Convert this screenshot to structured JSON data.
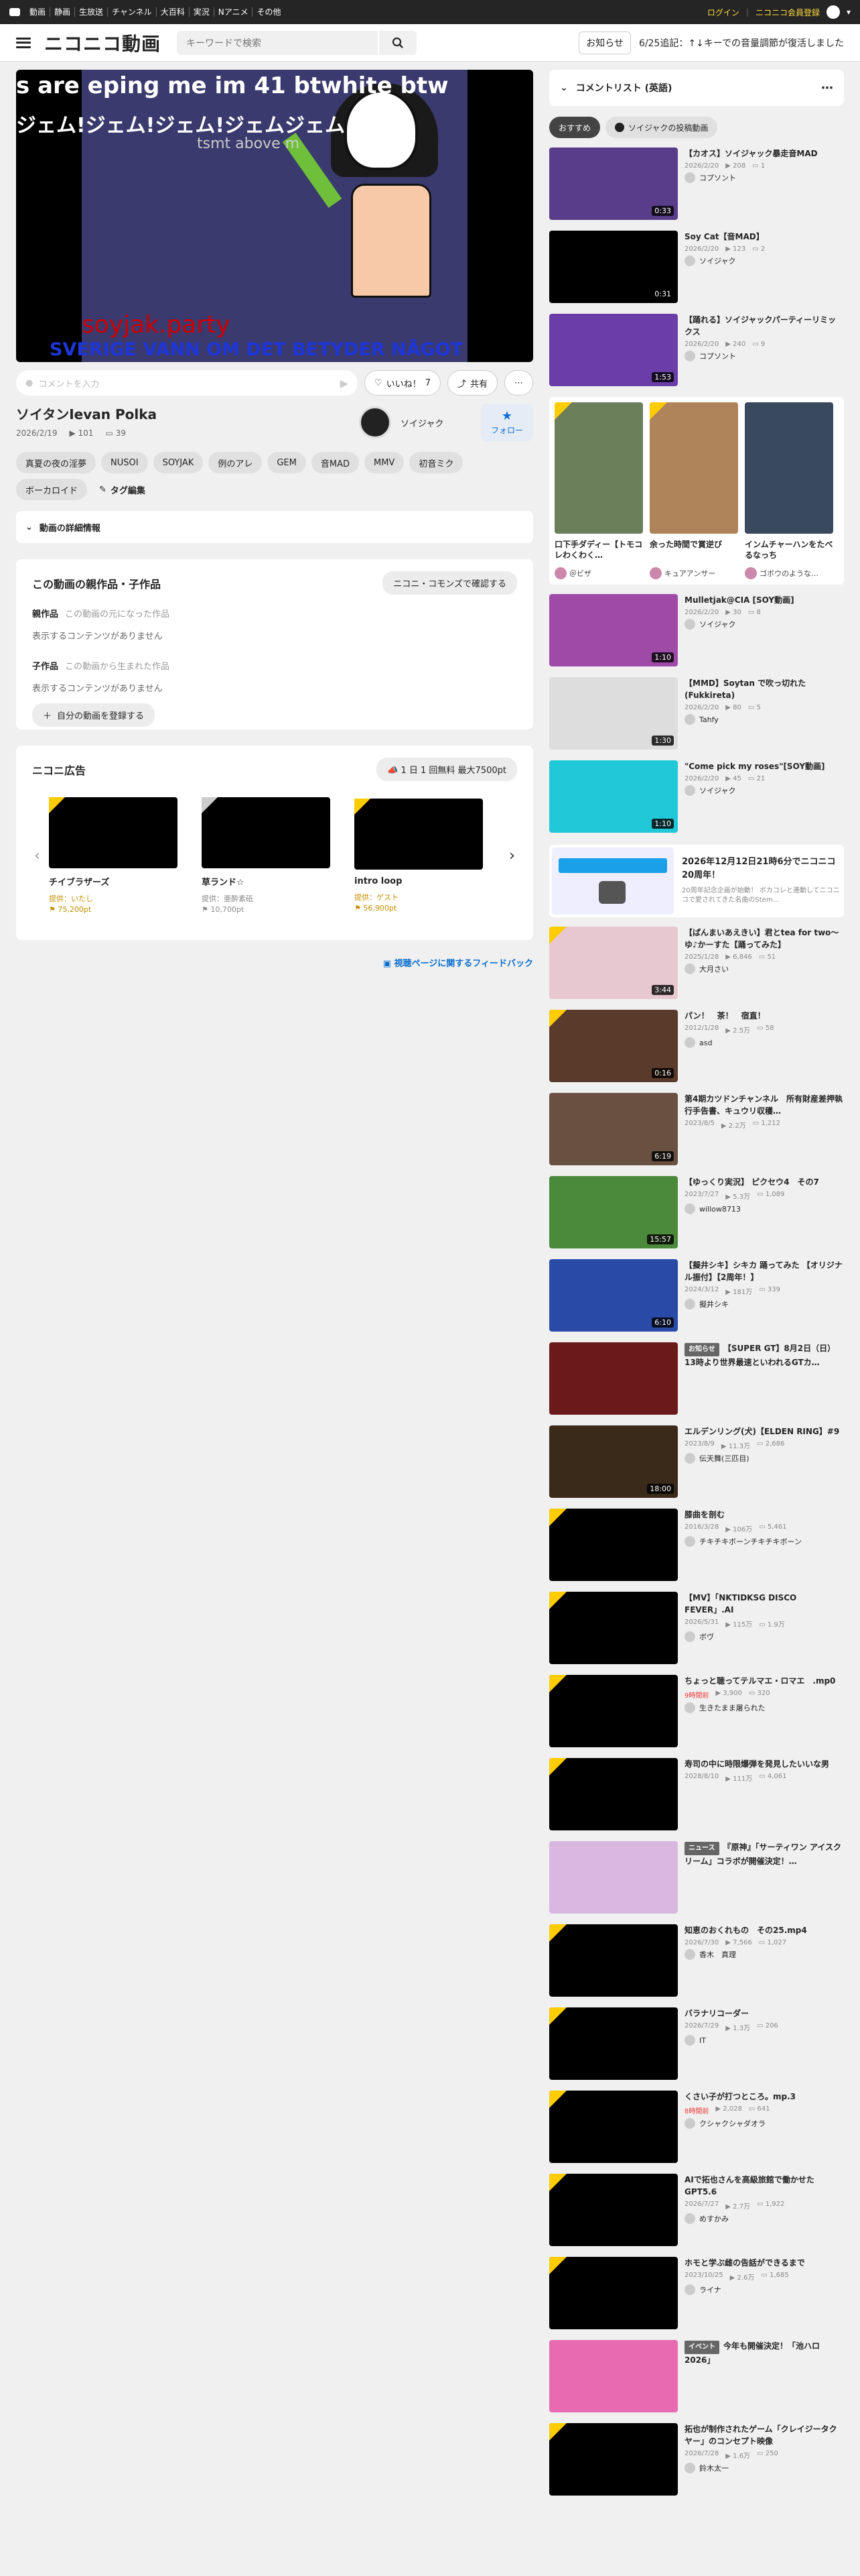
{
  "topbar": {
    "nav": [
      "動画",
      "静画",
      "生放送",
      "チャンネル",
      "大百科",
      "実況",
      "Nアニメ",
      "その他"
    ],
    "login": "ログイン",
    "register": "ニコニコ会員登録"
  },
  "header": {
    "logo": "ニコニコ動画",
    "search_placeholder": "キーワードで検索",
    "notice_label": "お知らせ",
    "notice_text": "6/25追記：↑↓キーでの音量調節が復活しました"
  },
  "player": {
    "line1": "s are eping me im 41 btwhite btw",
    "line2": "ジェム!ジェム!ジェム!ジェムジェム",
    "line3": "tsmt above m",
    "line4": "soyjak.party",
    "line5": "SVERIGE VANN OM DET BETYDER NÅGOT"
  },
  "commentbar": {
    "placeholder": "コメントを入力",
    "like_label": "いいね！",
    "like_count": "7",
    "share_label": "共有",
    "more": "⋯"
  },
  "video": {
    "title": "ソイタンIevan Polka",
    "date": "2026/2/19",
    "views": "101",
    "comments": "39",
    "owner": "ソイジャク",
    "follow_label": "フォロー"
  },
  "tags": [
    "真夏の夜の淫夢",
    "NUSOI",
    "SOYJAK",
    "例のアレ",
    "GEM",
    "音MAD",
    "MMV",
    "初音ミク",
    "ボーカロイド"
  ],
  "tag_edit": "タグ編集",
  "detail_label": "動画の詳細情報",
  "parents": {
    "title": "この動画の親作品・子作品",
    "commons_btn": "ニコニ・コモンズで確認する",
    "parent_label": "親作品",
    "parent_sub": "この動画の元になった作品",
    "parent_empty": "表示するコンテンツがありません",
    "child_label": "子作品",
    "child_sub": "この動画から生まれた作品",
    "child_empty": "表示するコンテンツがありません",
    "register_btn": "自分の動画を登録する"
  },
  "ads": {
    "title": "ニコニ広告",
    "free_btn": "1 日 1 回無料 最大7500pt",
    "items": [
      {
        "name": "チイブラザーズ",
        "provider": "提供：いたし",
        "points": "75,200pt",
        "gray": false
      },
      {
        "name": "草ランド☆",
        "provider": "提供：亜酔素砥",
        "points": "10,700pt",
        "gray": true
      },
      {
        "name": "intro loop",
        "provider": "提供：ゲスト",
        "points": "56,900pt",
        "gray": false
      }
    ]
  },
  "feedback": "視聴ページに関するフィードバック",
  "side": {
    "comment_list": "コメントリスト (英語)",
    "tab_recommend": "おすすめ",
    "tab_owner": "ソイジャクの投稿動画"
  },
  "recs_top": [
    {
      "title": "【カオス】ソイジャック暴走音MAD",
      "date": "2026/2/20",
      "views": "208",
      "comments": "1",
      "owner": "コプソント",
      "dur": "0:33",
      "bg": "#5a3d8a"
    },
    {
      "title": "Soy Cat【音MAD】",
      "date": "2026/2/20",
      "views": "123",
      "comments": "2",
      "owner": "ソイジャク",
      "dur": "0:31",
      "bg": "#000000"
    },
    {
      "title": "【踊れる】ソイジャックパーティーリミックス",
      "date": "2026/2/20",
      "views": "240",
      "comments": "9",
      "owner": "コプソント",
      "dur": "1:53",
      "bg": "#6b3da8"
    }
  ],
  "side_ads": [
    {
      "title": "口下手ダディー【トモコレわくわく…",
      "owner": "＠ビザ",
      "bg": "#6b7f5a"
    },
    {
      "title": "余った時間で賞逆び",
      "owner": "キュアアンサー",
      "bg": "#b0845a"
    },
    {
      "title": "インムチャーハンをたべるなっち",
      "owner": "ゴボウのような…",
      "bg": "#3a4a5e"
    }
  ],
  "recs_mid": [
    {
      "title": "Mulletjak@CIA [SOY動画]",
      "date": "2026/2/20",
      "views": "30",
      "comments": "8",
      "owner": "ソイジャク",
      "dur": "1:10",
      "bg": "#a04aa8"
    },
    {
      "title": "【MMD】Soytan で吹っ切れた(Fukkireta)",
      "date": "2026/2/20",
      "views": "80",
      "comments": "5",
      "owner": "Tahfy",
      "dur": "1:30",
      "bg": "#dddddd"
    },
    {
      "title": "\"Come pick my roses\"[SOY動画]",
      "date": "2026/2/20",
      "views": "45",
      "comments": "21",
      "owner": "ソイジャク",
      "dur": "1:10",
      "bg": "#20c8d8"
    }
  ],
  "promo": {
    "title": "2026年12月12日21時6分でニコニコ20周年！",
    "desc": "20周年記念企画が始動！ ボカコレと連動してニコニコで愛されてきた名曲のStem..."
  },
  "recs_bottom": [
    {
      "title": "【ぱんまいあえきい】君とtea for two〜ゆ♪かーすた【踊ってみた】",
      "date": "2025/1/28",
      "views": "6,846",
      "comments": "51",
      "owner": "大月さい",
      "dur": "3:44",
      "bg": "#e8c8d0",
      "corner": true
    },
    {
      "title": "パン！　茶！　宿直！",
      "date": "2012/1/28",
      "views": "2.5万",
      "comments": "58",
      "owner": "asd",
      "dur": "0:16",
      "bg": "#5a3a2a",
      "corner": true
    },
    {
      "title": "第4期カツドンチャンネル　所有財産差押執行手告書、キュウリ収穫…",
      "date": "2023/8/5",
      "views": "2.2万",
      "comments": "1,212",
      "owner": "",
      "dur": "6:19",
      "bg": "#6a5040",
      "corner": false
    },
    {
      "title": "【ゆっくり実況】 ピクセウ4　その7",
      "date": "2023/7/27",
      "views": "5.3万",
      "comments": "1,089",
      "owner": "willow8713",
      "dur": "15:57",
      "bg": "#4a8a3a",
      "corner": false
    },
    {
      "title": "【擬井シキ】シキカ 踊ってみた 【オリジナル振付】【2周年！】",
      "date": "2024/3/12",
      "views": "181万",
      "comments": "339",
      "owner": "擬井シキ",
      "dur": "6:10",
      "bg": "#2a4aa8",
      "corner": false
    },
    {
      "title": "【SUPER GT】8月2日（日）13時より世界最速といわれるGTカ…",
      "date": "",
      "views": "",
      "comments": "",
      "owner": "",
      "dur": "",
      "bg": "#6a1a1a",
      "corner": false,
      "badge": "お知らせ"
    },
    {
      "title": "エルデンリング(犬)【ELDEN RING】#9",
      "date": "2023/8/9",
      "views": "11.3万",
      "comments": "2,686",
      "owner": "伝天舞(三匹目)",
      "dur": "18:00",
      "bg": "#3a2a1a",
      "corner": false
    },
    {
      "title": "膝曲を剖む",
      "date": "2016/3/28",
      "views": "106万",
      "comments": "5,461",
      "owner": "チキチキボーンチキチキボーン",
      "dur": "",
      "bg": "#000000",
      "corner": true
    },
    {
      "title": "【MV】「NKTIDKSG DISCO FEVER」.AI",
      "date": "2026/5/31",
      "views": "115万",
      "comments": "1.9万",
      "owner": "ボヴ",
      "dur": "",
      "bg": "#000000",
      "corner": true
    },
    {
      "title": "ちょっと聴ってテルマエ・ロマエ　.mp0",
      "date": "",
      "views": "3,900",
      "comments": "320",
      "owner": "生きたまま屠られた",
      "dur": "",
      "bg": "#000000",
      "corner": true,
      "live": "9時間前"
    },
    {
      "title": "寿司の中に時限爆弾を発見したいいな男",
      "date": "2028/8/10",
      "views": "111万",
      "comments": "4,061",
      "owner": "",
      "dur": "",
      "bg": "#000000",
      "corner": true
    },
    {
      "title": "『原神』「サーティワン アイスクリーム」コラボが開催決定！…",
      "date": "",
      "views": "",
      "comments": "",
      "owner": "",
      "dur": "",
      "bg": "#d8b8e0",
      "corner": false,
      "badge": "ニュース"
    },
    {
      "title": "知恵のおくれもの　その25.mp4",
      "date": "2026/7/30",
      "views": "7,566",
      "comments": "1,027",
      "owner": "香木　真理",
      "dur": "",
      "bg": "#000000",
      "corner": true
    },
    {
      "title": "バラナリコーダー",
      "date": "2026/7/29",
      "views": "1.3万",
      "comments": "206",
      "owner": "IT",
      "dur": "",
      "bg": "#000000",
      "corner": true
    },
    {
      "title": "くさい子が打つところ。mp.3",
      "date": "",
      "views": "2,028",
      "comments": "641",
      "owner": "クシャクシャダオラ",
      "dur": "",
      "bg": "#000000",
      "corner": true,
      "live": "8時間前"
    },
    {
      "title": "AIで拓也さんを高級旅館で働かせたGPT5.6",
      "date": "2026/7/27",
      "views": "2.7万",
      "comments": "1,922",
      "owner": "めすかみ",
      "dur": "",
      "bg": "#000000",
      "corner": true
    },
    {
      "title": "ホモと学ぶ雌の告話ができるまで",
      "date": "2023/10/25",
      "views": "2.6万",
      "comments": "1,685",
      "owner": "ライナ",
      "dur": "",
      "bg": "#000000",
      "corner": true
    },
    {
      "title": "今年も開催決定！「池ハロ2026」",
      "date": "",
      "views": "",
      "comments": "",
      "owner": "",
      "dur": "",
      "bg": "#e86ab0",
      "corner": false,
      "badge": "イベント"
    },
    {
      "title": "拓也が制作されたゲーム「クレイジータクヤー」のコンセプト映像",
      "date": "2026/7/28",
      "views": "1.6万",
      "comments": "250",
      "owner": "鈴木太一",
      "dur": "",
      "bg": "#000000",
      "corner": true
    }
  ]
}
